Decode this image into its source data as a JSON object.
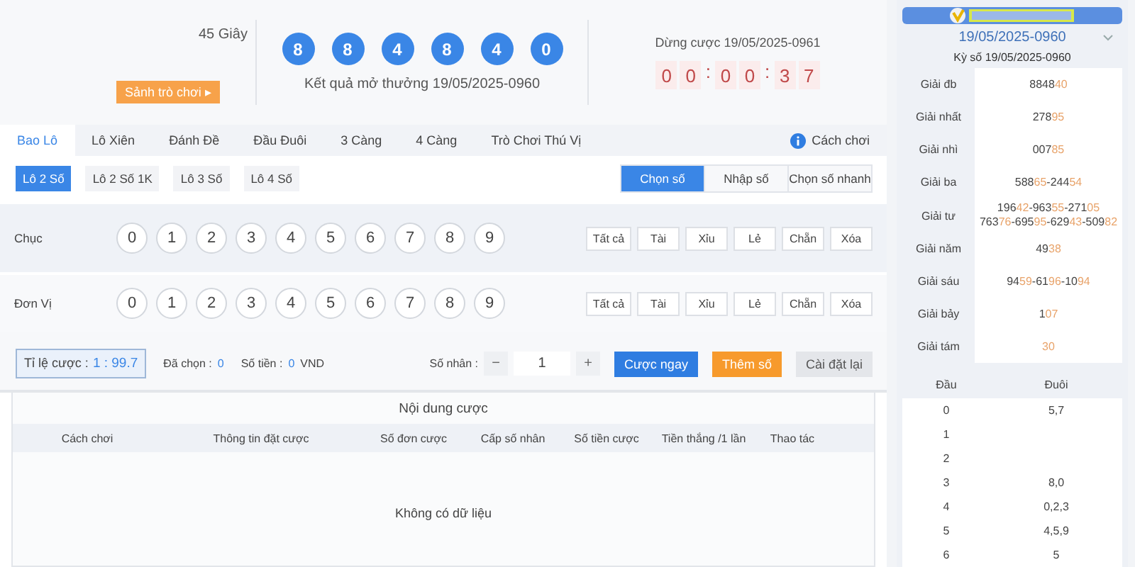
{
  "header": {
    "period_note": "45 Giây",
    "lobby_button": "Sảnh trò chơi ▸",
    "result_balls": [
      "8",
      "8",
      "4",
      "8",
      "4",
      "0"
    ],
    "result_caption": "Kết quả mở thưởng 19/05/2025-0960",
    "stop_label": "Dừng cược 19/05/2025-0961",
    "timer": [
      {
        "kind": "digit",
        "text": "0"
      },
      {
        "kind": "digit",
        "text": "0"
      },
      {
        "kind": "sep",
        "text": ":"
      },
      {
        "kind": "digit",
        "text": "0"
      },
      {
        "kind": "digit",
        "text": "0"
      },
      {
        "kind": "sep",
        "text": ":"
      },
      {
        "kind": "digit",
        "text": "3"
      },
      {
        "kind": "digit",
        "text": "7"
      }
    ]
  },
  "tabs": [
    {
      "label": "Bao Lô",
      "selected": true
    },
    {
      "label": "Lô Xiên",
      "selected": false
    },
    {
      "label": "Đánh Đề",
      "selected": false
    },
    {
      "label": "Đầu Đuôi",
      "selected": false
    },
    {
      "label": "3 Càng",
      "selected": false
    },
    {
      "label": "4 Càng",
      "selected": false
    },
    {
      "label": "Trò Chơi Thú Vị",
      "selected": false
    }
  ],
  "help_link": "Cách chơi",
  "sub_tabs": [
    {
      "label": "Lô 2 Số",
      "selected": true
    },
    {
      "label": "Lô 2 Số 1K",
      "selected": false
    },
    {
      "label": "Lô 3 Số",
      "selected": false
    },
    {
      "label": "Lô 4 Số",
      "selected": false
    }
  ],
  "modes": [
    {
      "label": "Chọn số",
      "selected": true
    },
    {
      "label": "Nhập số",
      "selected": false
    },
    {
      "label": "Chọn số nhanh",
      "selected": false
    }
  ],
  "pick_rows": [
    {
      "label": "Chục",
      "digits": [
        "0",
        "1",
        "2",
        "3",
        "4",
        "5",
        "6",
        "7",
        "8",
        "9"
      ],
      "quick": [
        "Tất cả",
        "Tài",
        "Xỉu",
        "Lẻ",
        "Chẵn",
        "Xóa"
      ]
    },
    {
      "label": "Đơn Vị",
      "digits": [
        "0",
        "1",
        "2",
        "3",
        "4",
        "5",
        "6",
        "7",
        "8",
        "9"
      ],
      "quick": [
        "Tất cả",
        "Tài",
        "Xỉu",
        "Lẻ",
        "Chẵn",
        "Xóa"
      ]
    }
  ],
  "bet_bar": {
    "odds_label": "Tỉ lệ cược :",
    "odds_value": "1 : 99.7",
    "chosen_label": "Đã chọn :",
    "chosen_value": "0",
    "amount_label": "Số tiền :",
    "amount_value": "0",
    "amount_unit": "VND",
    "multiplier_label": "Số nhân :",
    "minus": "−",
    "multiplier": "1",
    "plus": "+",
    "buttons": [
      {
        "kind": "primary",
        "label": "Cược ngay"
      },
      {
        "kind": "accent",
        "label": "Thêm số"
      },
      {
        "kind": "plain",
        "label": "Cài đặt lại"
      }
    ]
  },
  "bet_table": {
    "title": "Nội dung cược",
    "columns": [
      "Cách chơi",
      "Thông tin đặt cược",
      "Số đơn cược",
      "Cấp số nhân",
      "Số tiền cược",
      "Tiền thắng /1 lần",
      "Thao tác"
    ],
    "empty": "Không có dữ liệu"
  },
  "results": {
    "date": "19/05/2025-0960",
    "period": "Kỳ số 19/05/2025-0960",
    "separator": "-",
    "prizes": [
      {
        "name": "Giải đb",
        "lines": [
          [
            {
              "head": "8848",
              "tail": "40"
            }
          ]
        ]
      },
      {
        "name": "Giải nhất",
        "lines": [
          [
            {
              "head": "278",
              "tail": "95"
            }
          ]
        ]
      },
      {
        "name": "Giải nhì",
        "lines": [
          [
            {
              "head": "007",
              "tail": "85"
            }
          ]
        ]
      },
      {
        "name": "Giải ba",
        "lines": [
          [
            {
              "head": "588",
              "tail": "65"
            },
            {
              "head": "244",
              "tail": "54"
            }
          ]
        ]
      },
      {
        "name": "Giải tư",
        "lines": [
          [
            {
              "head": "196",
              "tail": "42"
            },
            {
              "head": "963",
              "tail": "55"
            },
            {
              "head": "271",
              "tail": "05"
            }
          ],
          [
            {
              "head": "763",
              "tail": "76"
            },
            {
              "head": "695",
              "tail": "95"
            },
            {
              "head": "629",
              "tail": "43"
            },
            {
              "head": "509",
              "tail": "82"
            }
          ]
        ]
      },
      {
        "name": "Giải năm",
        "lines": [
          [
            {
              "head": "49",
              "tail": "38"
            }
          ]
        ]
      },
      {
        "name": "Giải sáu",
        "lines": [
          [
            {
              "head": "94",
              "tail": "59"
            },
            {
              "head": "61",
              "tail": "96"
            },
            {
              "head": "10",
              "tail": "94"
            }
          ]
        ]
      },
      {
        "name": "Giải bảy",
        "lines": [
          [
            {
              "head": "1",
              "tail": "07"
            }
          ]
        ]
      },
      {
        "name": "Giải tám",
        "lines": [
          [
            {
              "tail": "30"
            }
          ]
        ]
      }
    ],
    "head_tail_columns": [
      "Đầu",
      "Đuôi"
    ],
    "head_tail": [
      {
        "head": "0",
        "tail": "5,7"
      },
      {
        "head": "1"
      },
      {
        "head": "2"
      },
      {
        "head": "3",
        "tail": "8,0"
      },
      {
        "head": "4",
        "tail": "0,2,3"
      },
      {
        "head": "5",
        "tail": "4,5,9"
      },
      {
        "head": "6",
        "tail": "5"
      }
    ]
  }
}
